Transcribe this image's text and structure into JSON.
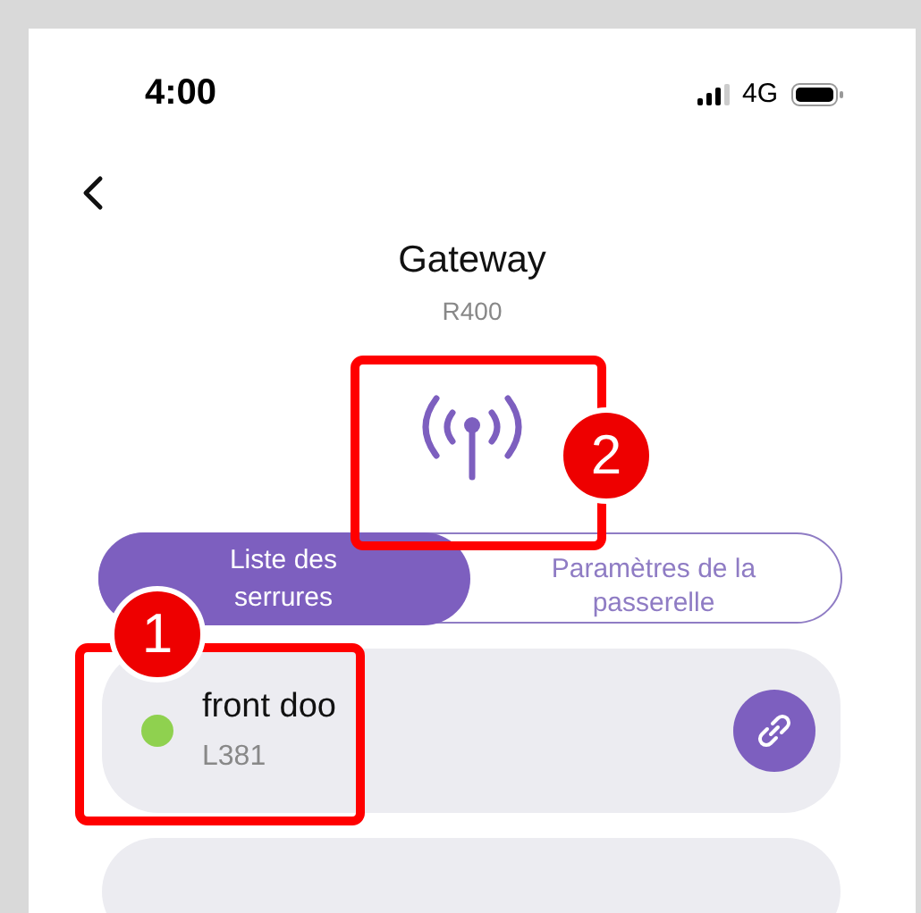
{
  "status_bar": {
    "time": "4:00",
    "network": "4G"
  },
  "header": {
    "title": "Gateway",
    "model": "R400"
  },
  "tabs": [
    {
      "label": "Liste des serrures",
      "selected": true
    },
    {
      "label": "Paramètres de la passerelle",
      "selected": false
    }
  ],
  "locks": [
    {
      "name": "front doo",
      "model": "L381",
      "color": "#8fd14f"
    }
  ],
  "annotations": [
    {
      "label": "1"
    },
    {
      "label": "2"
    }
  ]
}
